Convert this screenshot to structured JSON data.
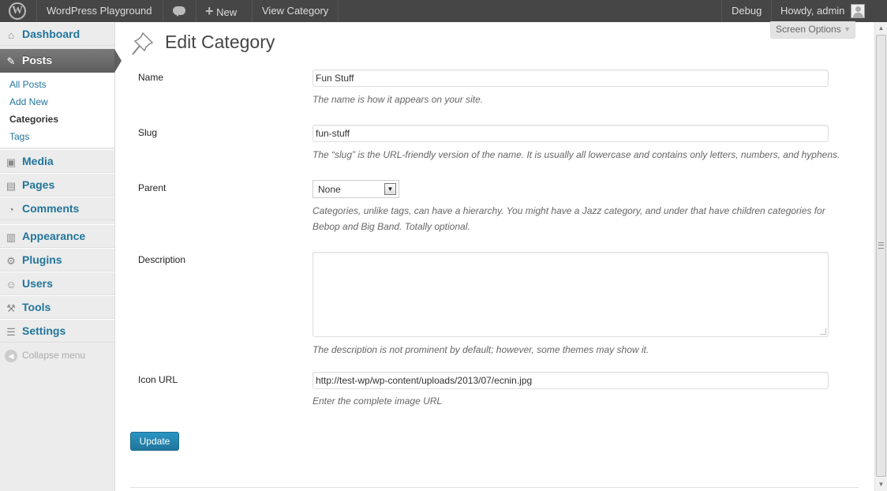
{
  "adminbar": {
    "site_name": "WordPress Playground",
    "new_label": "New",
    "view_label": "View Category",
    "debug_label": "Debug",
    "howdy": "Howdy, admin"
  },
  "sidebar": {
    "dashboard": "Dashboard",
    "posts": "Posts",
    "posts_submenu": [
      "All Posts",
      "Add New",
      "Categories",
      "Tags"
    ],
    "current_submenu": "Categories",
    "media": "Media",
    "pages": "Pages",
    "comments": "Comments",
    "appearance": "Appearance",
    "plugins": "Plugins",
    "users": "Users",
    "tools": "Tools",
    "settings": "Settings",
    "collapse": "Collapse menu"
  },
  "screen_options": "Screen Options",
  "page": {
    "title": "Edit Category",
    "fields": {
      "name": {
        "label": "Name",
        "value": "Fun Stuff",
        "help": "The name is how it appears on your site."
      },
      "slug": {
        "label": "Slug",
        "value": "fun-stuff",
        "help": "The “slug” is the URL-friendly version of the name. It is usually all lowercase and contains only letters, numbers, and hyphens."
      },
      "parent": {
        "label": "Parent",
        "value": "None",
        "help_line1": "Categories, unlike tags, can have a hierarchy. You might have a Jazz category, and under that have children categories for",
        "help_line2": "Bebop and Big Band. Totally optional."
      },
      "description": {
        "label": "Description",
        "value": "",
        "help": "The description is not prominent by default; however, some themes may show it."
      },
      "icon_url": {
        "label": "Icon URL",
        "value": "http://test-wp/wp-content/uploads/2013/07/ecnin.jpg",
        "help": "Enter the complete image URL"
      }
    },
    "update_button": "Update"
  },
  "colors": {
    "accent": "#21759b",
    "adminbar": "#464646",
    "menu_bg": "#ececec"
  }
}
